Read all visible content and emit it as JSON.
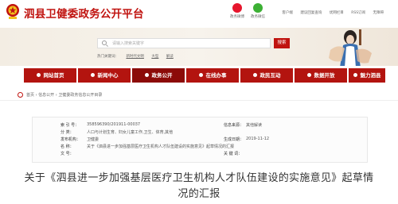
{
  "header": {
    "site_title": "泗县卫健委政务公开平台",
    "social": [
      {
        "label": "政务微博",
        "icon": "weibo-icon",
        "color": "#e6162d"
      },
      {
        "label": "政务微信",
        "icon": "wechat-icon",
        "color": "#3cb034"
      }
    ],
    "links": [
      "客户端",
      "建议回复查询",
      "优网栏目",
      "RSS订阅",
      "无障碍"
    ]
  },
  "search": {
    "placeholder": "请输入搜索关键字",
    "button": "搜索",
    "hot_label": "热门关键词：",
    "hot_words": [
      "新时代文明",
      "大型",
      "解读"
    ]
  },
  "nav": [
    {
      "label": "网站首页",
      "icon": "home-icon"
    },
    {
      "label": "新闻中心",
      "icon": "news-icon"
    },
    {
      "label": "政务公开",
      "icon": "open-icon",
      "active": true
    },
    {
      "label": "在线办事",
      "icon": "service-icon"
    },
    {
      "label": "政民互动",
      "icon": "interaction-icon"
    },
    {
      "label": "数据开放",
      "icon": "data-icon"
    },
    {
      "label": "魅力泗县",
      "icon": "charm-icon"
    }
  ],
  "breadcrumb": "首页 › 信息公开 › 卫健委政务信息公开目录",
  "meta": {
    "index_label": "索 引 号：",
    "index_value": "358596390/201911-00037",
    "category_label": "分 类：",
    "category_value": "人口与计划生育、妇女儿童工作,卫生、体育,其他",
    "publisher_label": "发布机构：",
    "publisher_value": "卫健委",
    "name_label": "名 称：",
    "name_value": "关于《泗县进一步加强基层医疗卫生机构人才队伍建设的实施意见》起草情况的汇报",
    "docno_label": "文 号：",
    "docno_value": "",
    "source_label": "信息来源：",
    "source_value": "其他解读",
    "date_label": "生成日期：",
    "date_value": "2019-11-12",
    "keyword_label": "关 键 词：",
    "keyword_value": ""
  },
  "doc_title": "关于《泗县进一步加强基层医疗卫生机构人才队伍建设的实施意见》起草情况的汇报"
}
